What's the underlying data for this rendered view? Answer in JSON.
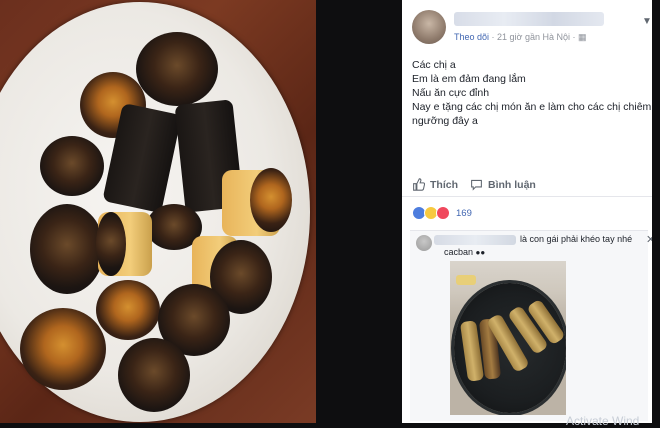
{
  "post": {
    "follow": "Theo dõi",
    "meta": "· 21 giờ gần Hà Nội ·",
    "privacy_icon": "friends-icon",
    "menu_icon": "chevron-down-icon",
    "lines": [
      "Các chị a",
      "Em là em đảm đang lắm",
      "Nấu ăn cực đỉnh",
      "Nay e tặng các chị món ăn e làm cho các chị chiêm",
      "ngưỡng đây a"
    ],
    "like_label": "Thích",
    "comment_label": "Bình luận",
    "reaction_count": "169"
  },
  "comment": {
    "text_line1": "là con gái phải khéo tay nhé",
    "text_line2": "cacban",
    "close_icon": "close-icon"
  },
  "watermark": "Activate Wind"
}
